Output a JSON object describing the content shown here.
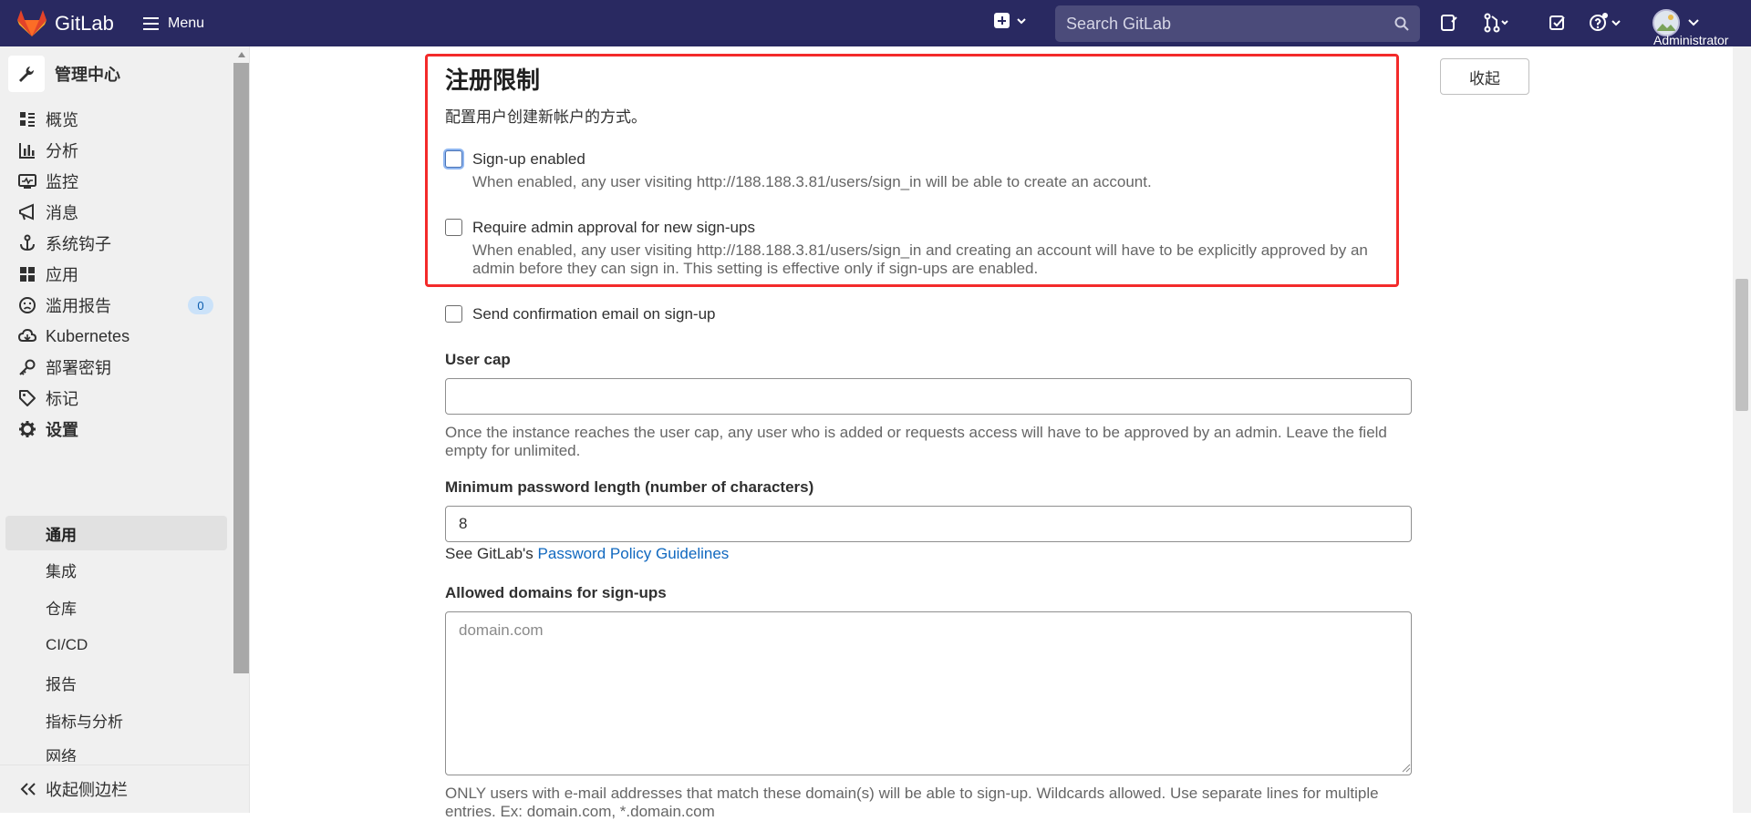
{
  "navbar": {
    "brand": "GitLab",
    "menu_label": "Menu",
    "search_placeholder": "Search GitLab",
    "user_label": "Administrator"
  },
  "sidebar": {
    "title": "管理中心",
    "items": [
      {
        "label": "概览",
        "icon": "overview-icon"
      },
      {
        "label": "分析",
        "icon": "analytics-icon"
      },
      {
        "label": "监控",
        "icon": "monitor-icon"
      },
      {
        "label": "消息",
        "icon": "messages-icon"
      },
      {
        "label": "系统钩子",
        "icon": "hook-icon"
      },
      {
        "label": "应用",
        "icon": "applications-icon"
      },
      {
        "label": "滥用报告",
        "icon": "abuse-reports-icon",
        "badge": "0"
      },
      {
        "label": "Kubernetes",
        "icon": "kubernetes-icon"
      },
      {
        "label": "部署密钥",
        "icon": "key-icon"
      },
      {
        "label": "标记",
        "icon": "label-icon"
      },
      {
        "label": "设置",
        "icon": "settings-icon"
      }
    ],
    "sub_items": [
      {
        "label": "通用",
        "active": true
      },
      {
        "label": "集成"
      },
      {
        "label": "仓库"
      },
      {
        "label": "CI/CD"
      },
      {
        "label": "报告"
      },
      {
        "label": "指标与分析"
      },
      {
        "label": "网络"
      }
    ],
    "collapse_label": "收起侧边栏"
  },
  "section": {
    "title": "注册限制",
    "description": "配置用户创建新帐户的方式。",
    "collapse_button": "收起"
  },
  "form": {
    "signup_enabled": {
      "label": "Sign-up enabled",
      "help": "When enabled, any user visiting http://188.188.3.81/users/sign_in will be able to create an account.",
      "checked": false
    },
    "admin_approval": {
      "label": "Require admin approval for new sign-ups",
      "help_line1": "When enabled, any user visiting http://188.188.3.81/users/sign_in and creating an account will have to be explicitly approved by an",
      "help_line2": "admin before they can sign in. This setting is effective only if sign-ups are enabled.",
      "checked": false
    },
    "confirmation_email": {
      "label": "Send confirmation email on sign-up",
      "checked": false
    },
    "user_cap": {
      "label": "User cap",
      "value": "",
      "help_line1": "Once the instance reaches the user cap, any user who is added or requests access will have to be approved by an admin. Leave the field",
      "help_line2": "empty for unlimited."
    },
    "min_password": {
      "label": "Minimum password length (number of characters)",
      "value": "8",
      "help_prefix": "See GitLab's ",
      "help_link": "Password Policy Guidelines"
    },
    "allowed_domains": {
      "label": "Allowed domains for sign-ups",
      "placeholder": "domain.com",
      "help_line1": "ONLY users with e-mail addresses that match these domain(s) will be able to sign-up. Wildcards allowed. Use separate lines for multiple",
      "help_line2": "entries. Ex: domain.com, *.domain.com"
    }
  },
  "colors": {
    "navbar": "#292961",
    "highlight_box": "#f32a2a",
    "link": "#1068bf"
  }
}
